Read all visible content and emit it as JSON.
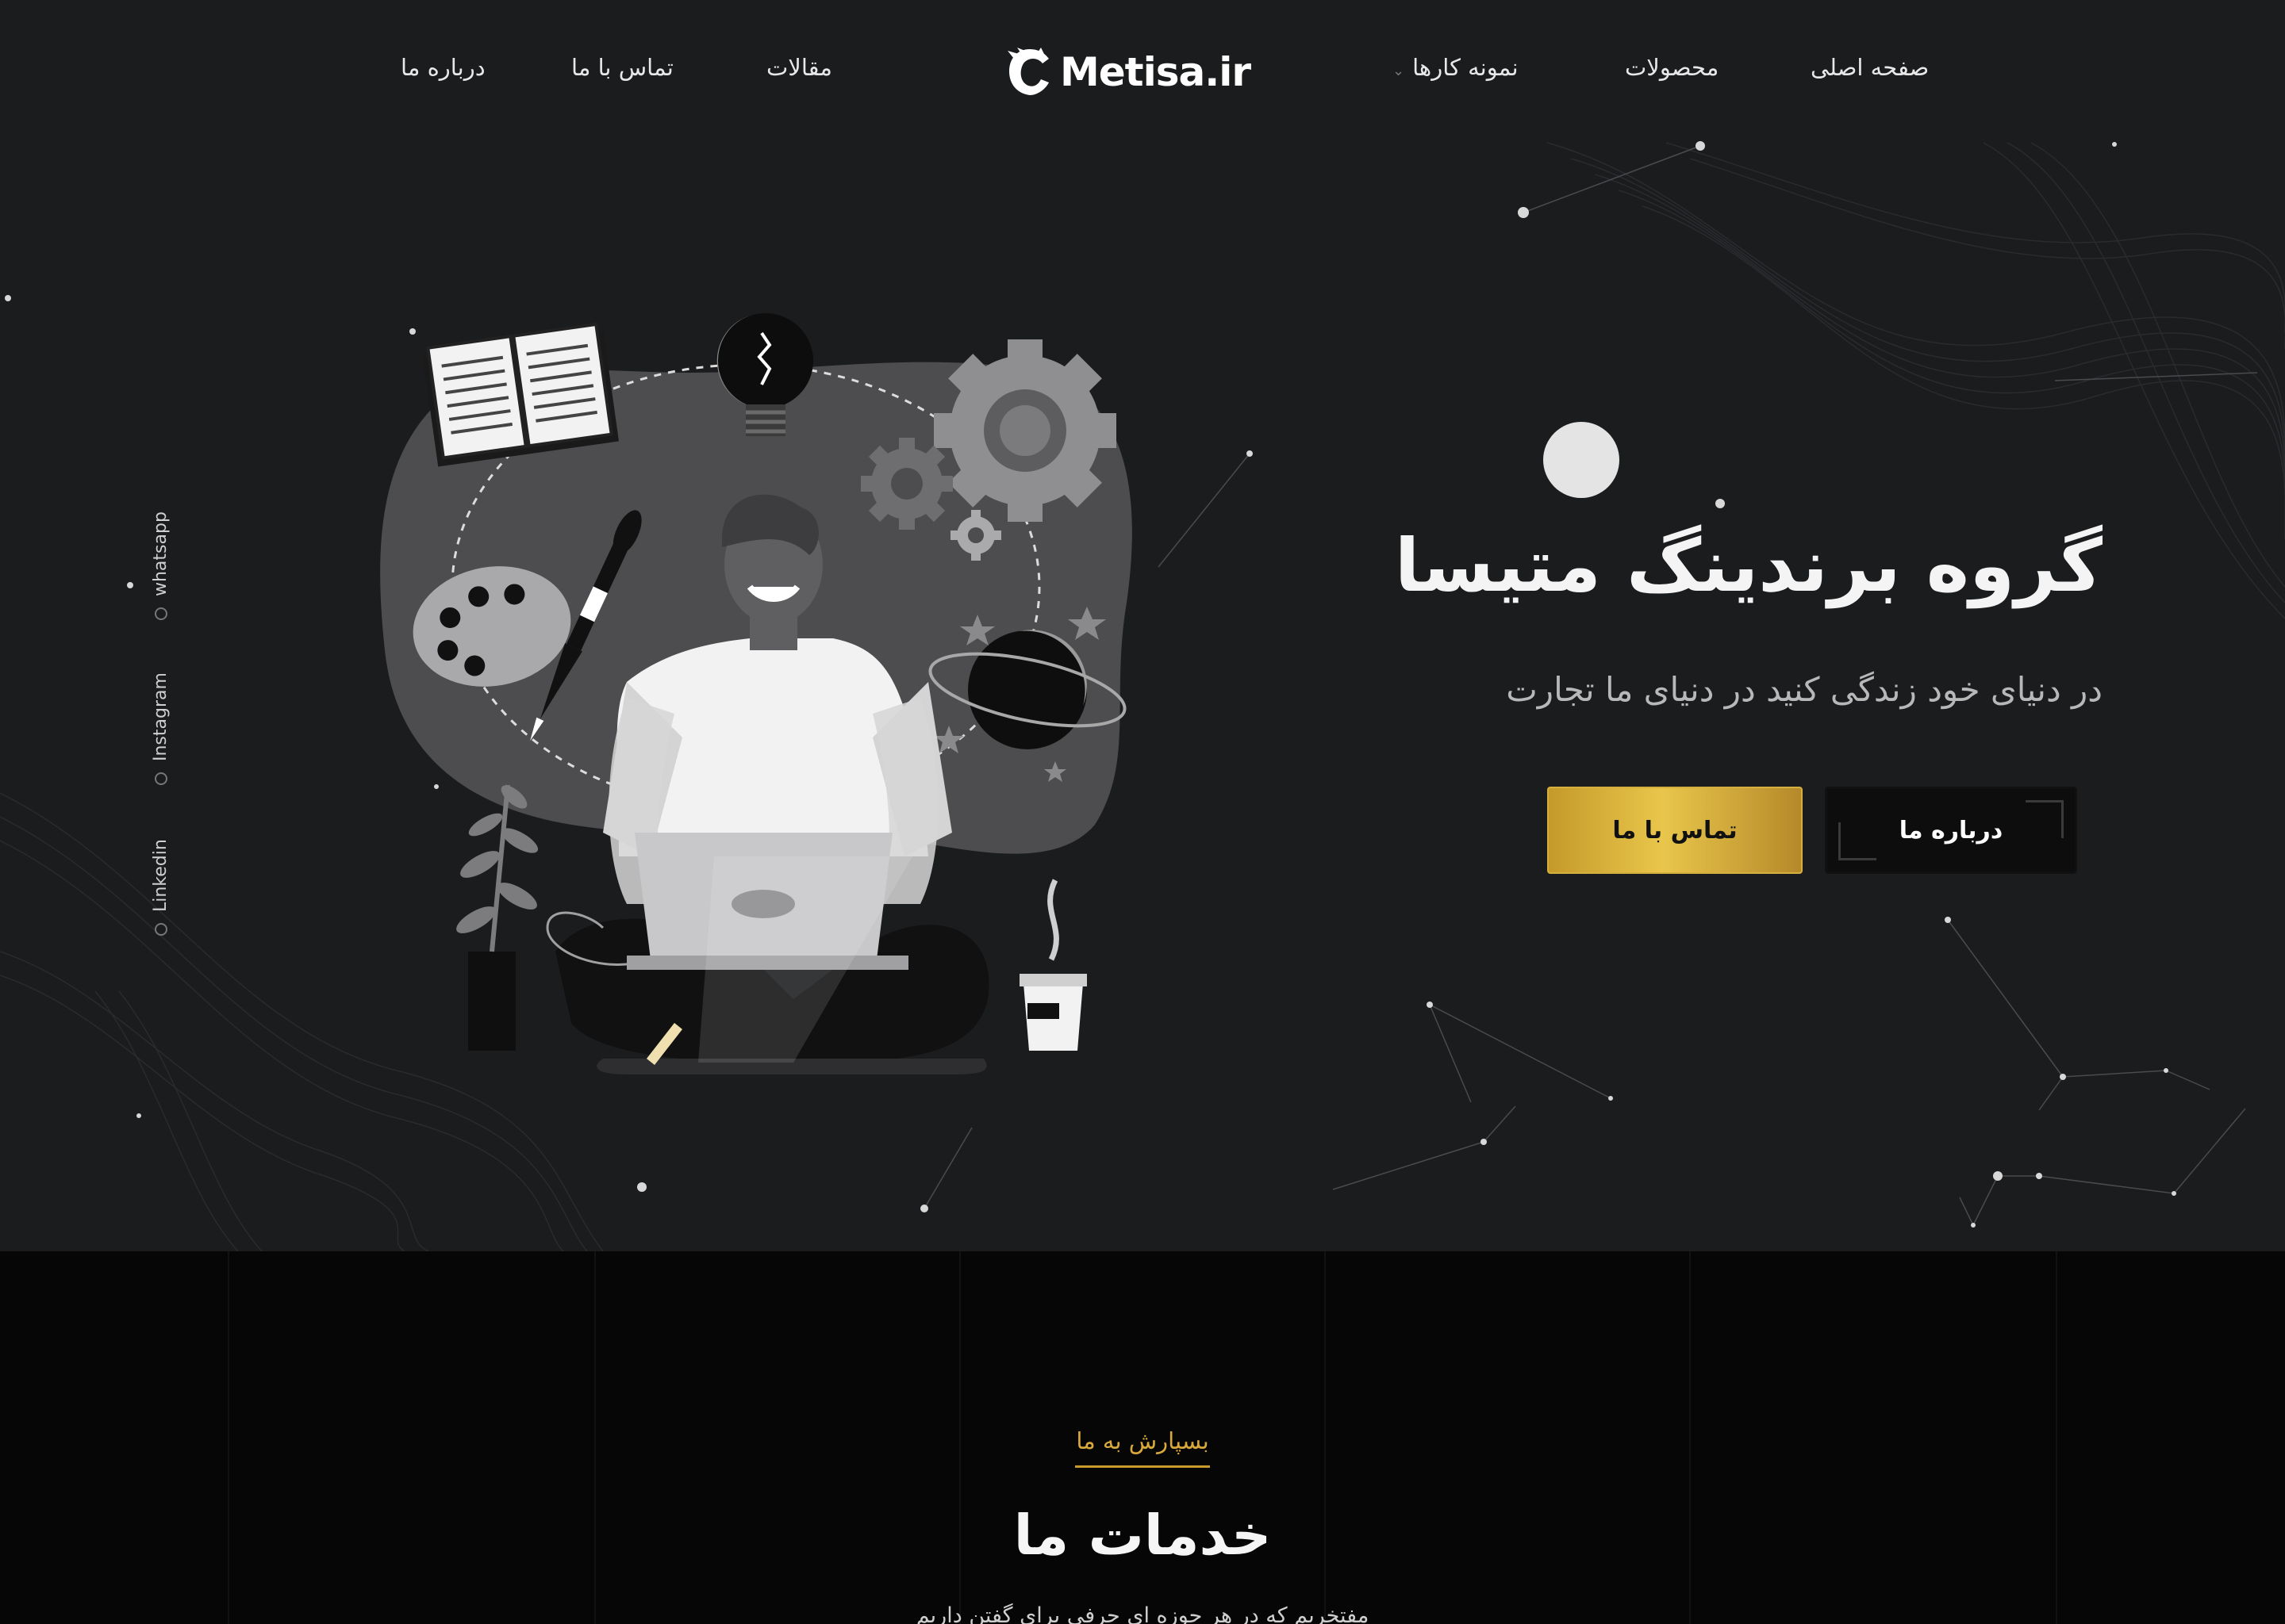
{
  "nav": {
    "home": "صفحه اصلی",
    "products": "محصولات",
    "portfolio": "نمونه کارها",
    "articles": "مقالات",
    "contact": "تماس با ما",
    "about": "درباره ما",
    "logo_text": "Metisa.ir"
  },
  "hero": {
    "title": "گروه برندینگ متیسا",
    "subtitle": "در دنیای خود زندگی کنید در دنیای ما تجارت",
    "about_button": "درباره ما",
    "contact_button": "تماس با ما"
  },
  "social": {
    "whatsapp": "whatsapp",
    "instagram": "Instagram",
    "linkedin": "Linkedin"
  },
  "services": {
    "eyebrow": "بسپارش به ما",
    "title": "خدمات ما",
    "description": "مفتخریم که در هر حوزه ای حرفی برای گفتن داریم"
  },
  "colors": {
    "background": "#1b1c1e",
    "gold": "#d9a93b",
    "services_bg": "#060606"
  }
}
